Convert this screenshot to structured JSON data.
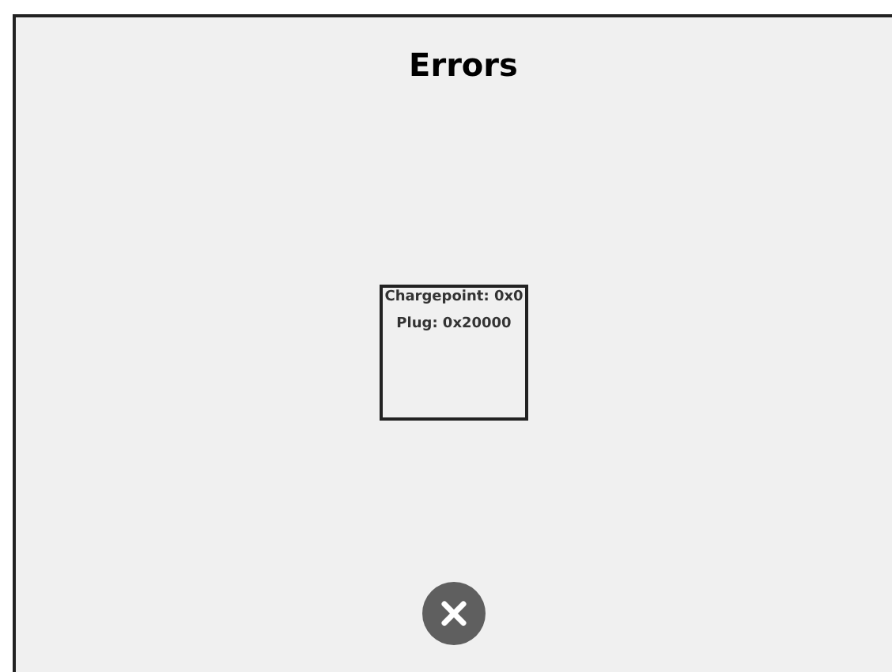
{
  "title": "Errors",
  "errors": [
    {
      "text": "Chargepoint: 0x0"
    },
    {
      "text": "Plug: 0x20000"
    }
  ]
}
